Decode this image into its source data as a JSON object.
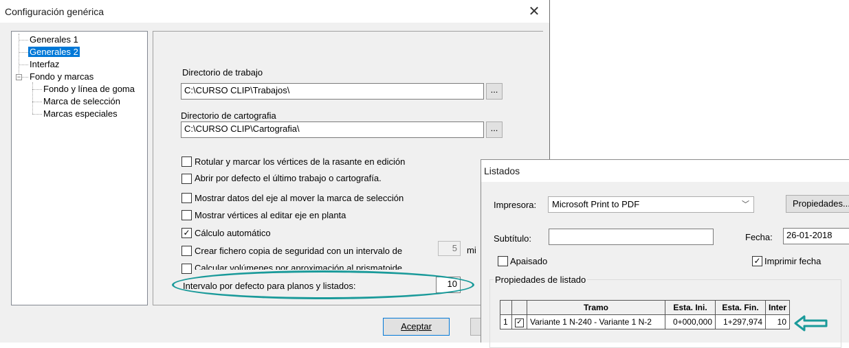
{
  "main_dialog": {
    "title": "Configuración genérica",
    "tree": {
      "items": [
        {
          "label": "Generales 1"
        },
        {
          "label": "Generales 2"
        },
        {
          "label": "Interfaz"
        },
        {
          "label": "Fondo y marcas"
        },
        {
          "label": "Fondo y línea de goma"
        },
        {
          "label": "Marca de selección"
        },
        {
          "label": "Marcas especiales"
        }
      ],
      "selected": "Generales 2"
    },
    "work_dir": {
      "label": "Directorio de trabajo",
      "value": "C:\\CURSO CLIP\\Trabajos\\",
      "browse": "..."
    },
    "carto_dir": {
      "label": "Directorio de cartografia",
      "value": "C:\\CURSO CLIP\\Cartografia\\",
      "browse": "..."
    },
    "options": [
      {
        "label": "Rotular y marcar los vértices de la rasante en edición",
        "checked": false
      },
      {
        "label": "Abrir por defecto el último trabajo o cartografía.",
        "checked": false
      },
      {
        "label": "Mostrar datos del eje al mover la marca de selección",
        "checked": false
      },
      {
        "label": "Mostrar vértices al editar eje en planta",
        "checked": false
      },
      {
        "label": "Cálculo automático",
        "checked": true
      },
      {
        "label": "Crear fichero copia de seguridad con un intervalo de",
        "checked": false
      },
      {
        "label": "Calcular volúmenes por aproximación al prismatoide",
        "checked": false
      }
    ],
    "backup_interval": {
      "value": "5",
      "unit": "mi"
    },
    "default_interval": {
      "label": "Intervalo por defecto para planos y listados:",
      "value": "10"
    },
    "accept_button": "Aceptar"
  },
  "listados_dialog": {
    "title": "Listados",
    "printer": {
      "label": "Impresora:",
      "value": "Microsoft Print to PDF",
      "properties_button": "Propiedades..."
    },
    "subtitle": {
      "label": "Subtítulo:",
      "value": ""
    },
    "date": {
      "label": "Fecha:",
      "value": "26-01-2018"
    },
    "landscape": {
      "label": "Apaisado",
      "checked": false
    },
    "print_date": {
      "label": "Imprimir fecha",
      "checked": true
    },
    "group_label": "Propiedades de listado",
    "table": {
      "columns": [
        "",
        "",
        "Tramo",
        "Esta. Ini.",
        "Esta. Fin.",
        "Inter"
      ],
      "rows": [
        {
          "num": "1",
          "checked": true,
          "tramo": "Variante 1 N-240 - Variante 1 N-2",
          "ini": "0+000,000",
          "fin": "1+297,974",
          "inter": "10"
        }
      ]
    }
  },
  "colors": {
    "highlight": "#1a9a9a",
    "selection": "#0078d7"
  }
}
